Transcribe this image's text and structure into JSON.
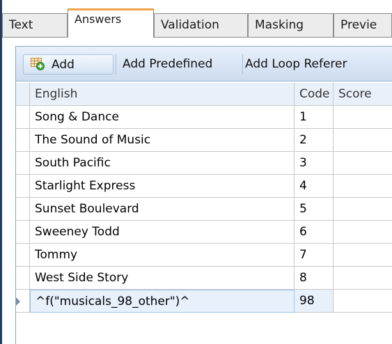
{
  "tabs": [
    {
      "label": "Text",
      "active": false
    },
    {
      "label": "Answers",
      "active": true
    },
    {
      "label": "Validation",
      "active": false
    },
    {
      "label": "Masking",
      "active": false
    },
    {
      "label": "Previe",
      "active": false
    }
  ],
  "toolbar": {
    "add_label": "Add",
    "add_icon": "add-row-icon",
    "add_predefined_label": "Add Predefined",
    "add_loop_reference_label": "Add Loop Referer"
  },
  "grid": {
    "columns": [
      "English",
      "Code",
      "Score"
    ],
    "rows": [
      {
        "english": "Song & Dance",
        "code": "1",
        "score": ""
      },
      {
        "english": "The Sound of Music",
        "code": "2",
        "score": ""
      },
      {
        "english": "South Pacific",
        "code": "3",
        "score": ""
      },
      {
        "english": "Starlight Express",
        "code": "4",
        "score": ""
      },
      {
        "english": "Sunset Boulevard",
        "code": "5",
        "score": ""
      },
      {
        "english": "Sweeney Todd",
        "code": "6",
        "score": ""
      },
      {
        "english": "Tommy",
        "code": "7",
        "score": ""
      },
      {
        "english": "West Side Story",
        "code": "8",
        "score": ""
      },
      {
        "english": "^f(\"musicals_98_other\")^",
        "code": "98",
        "score": ""
      }
    ],
    "selected_row_index": 8
  },
  "colors": {
    "active_tab_accent": "#f0a34a",
    "toolbar_bg": "#cddcef",
    "header_bg": "#eaf0f8",
    "window_edge": "#243c5c"
  }
}
